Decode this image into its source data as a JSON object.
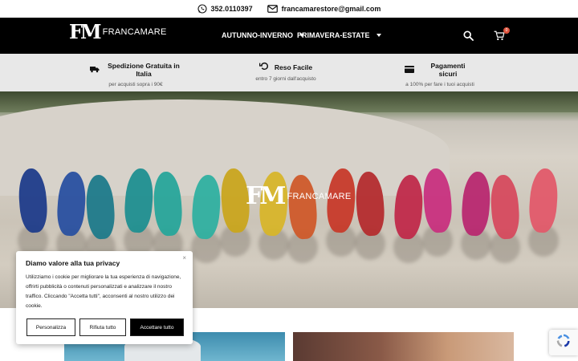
{
  "topbar": {
    "phone": "352.0110397",
    "email": "francamarestore@gmail.com"
  },
  "brand": {
    "logo_mark": "FM",
    "logo_word": "FRANCAMARE"
  },
  "nav": {
    "items": [
      {
        "label": "AUTUNNO-INVERNO"
      },
      {
        "label": "PRIMAVERA-ESTATE"
      }
    ],
    "cart_count": "0"
  },
  "features": [
    {
      "icon": "truck-icon",
      "title": "Spedizione Gratuita in Italia",
      "subtitle": "per acquisti sopra i 90€"
    },
    {
      "icon": "undo-icon",
      "title": "Reso Facile",
      "subtitle": "entro 7 giorni dall'acquisto"
    },
    {
      "icon": "credit-card-icon",
      "title": "Pagamenti sicuri",
      "subtitle": "a 100% per fare i tuoi acquisti"
    }
  ],
  "hero": {
    "logo_mark": "FM",
    "logo_word": "FRANCAMARE",
    "sandal_colors": [
      "#1f3c8a",
      "#2950a0",
      "#1d7a8a",
      "#1f8f90",
      "#27a59a",
      "#2fb0a0",
      "#c9a51e",
      "#d7b52a",
      "#cf5a2a",
      "#c73a2a",
      "#b42c2e",
      "#c02a4a",
      "#c8307e",
      "#b82870",
      "#d64a5e",
      "#e25a6a"
    ]
  },
  "cookie": {
    "title": "Diamo valore alla tua privacy",
    "text": "Utilizziamo i cookie per migliorare la tua esperienza di navigazione, offrirti pubblicità o contenuti personalizzati e analizzare il nostro traffico. Cliccando \"Accetta tutti\", acconsenti al nostro utilizzo dei cookie.",
    "close": "×",
    "buttons": {
      "customize": "Personalizza",
      "reject": "Rifiuta tutto",
      "accept": "Accettare tutto"
    }
  }
}
